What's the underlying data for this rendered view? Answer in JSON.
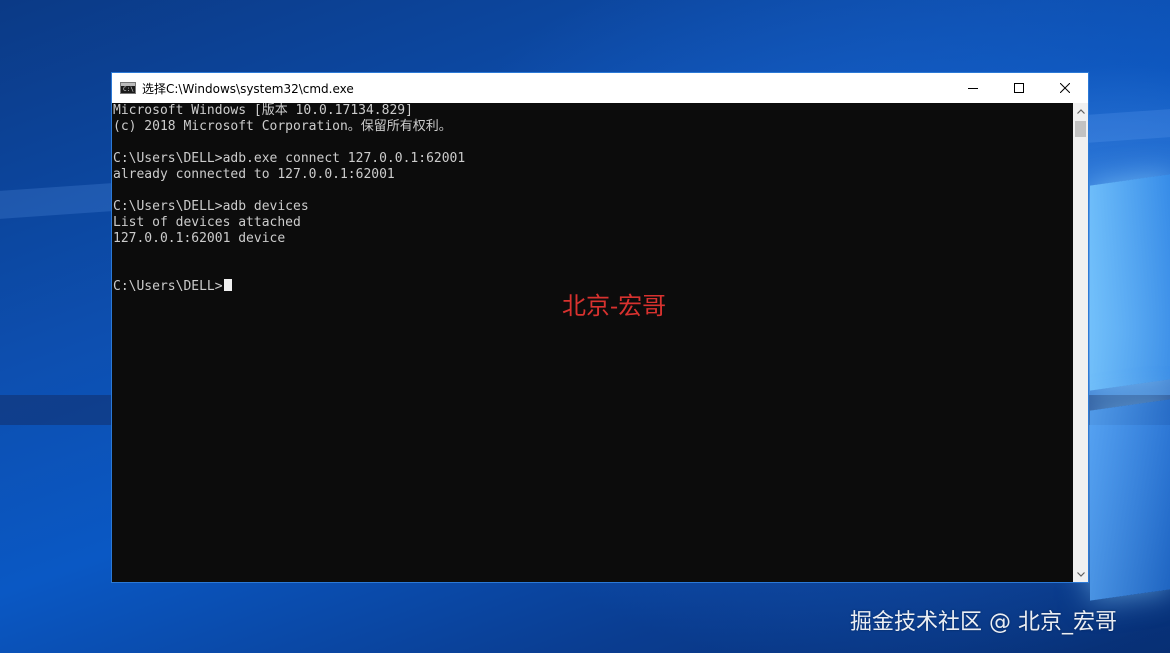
{
  "window": {
    "title": "选择C:\\Windows\\system32\\cmd.exe",
    "app_icon_label": "C:\\"
  },
  "caption_buttons": {
    "minimize": "minimize-icon",
    "maximize": "maximize-icon",
    "close": "close-icon"
  },
  "console": {
    "lines": [
      "Microsoft Windows [版本 10.0.17134.829]",
      "(c) 2018 Microsoft Corporation。保留所有权利。",
      "",
      "C:\\Users\\DELL>adb.exe connect 127.0.0.1:62001",
      "already connected to 127.0.0.1:62001",
      "",
      "C:\\Users\\DELL>adb devices",
      "List of devices attached",
      "127.0.0.1:62001 device",
      "",
      "",
      "C:\\Users\\DELL>"
    ],
    "text_color": "#cccccc",
    "background": "#0c0c0c"
  },
  "overlay": {
    "red_watermark": "北京-宏哥",
    "bottom_watermark": "掘金技术社区 @ 北京_宏哥"
  }
}
